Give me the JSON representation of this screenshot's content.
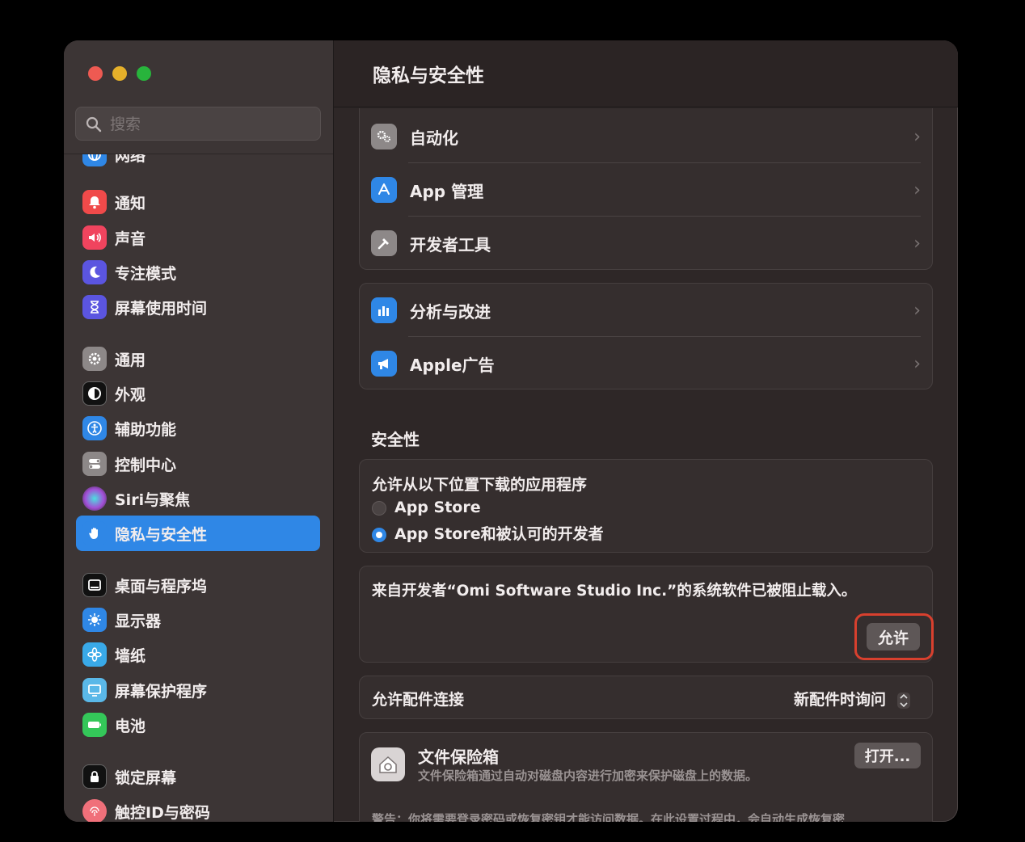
{
  "window": {
    "title": "隐私与安全性"
  },
  "search": {
    "placeholder": "搜索"
  },
  "sidebar": {
    "partial_item": "网络",
    "items": [
      {
        "label": "通知",
        "icon": "bell-icon",
        "color": "#f04a4a"
      },
      {
        "label": "声音",
        "icon": "speaker-icon",
        "color": "#f0445e"
      },
      {
        "label": "专注模式",
        "icon": "moon-icon",
        "color": "#5b55e0"
      },
      {
        "label": "屏幕使用时间",
        "icon": "hourglass-icon",
        "color": "#5b55e0"
      },
      {
        "label": "通用",
        "icon": "gear-icon",
        "color": "#8d8888"
      },
      {
        "label": "外观",
        "icon": "appearance-icon",
        "color": "#111111"
      },
      {
        "label": "辅助功能",
        "icon": "accessibility-icon",
        "color": "#2f87e6"
      },
      {
        "label": "控制中心",
        "icon": "toggles-icon",
        "color": "#8d8888"
      },
      {
        "label": "Siri与聚焦",
        "icon": "siri-icon",
        "color": "#a34fd6"
      },
      {
        "label": "隐私与安全性",
        "icon": "hand-icon",
        "color": "#2f87e6",
        "selected": true
      },
      {
        "label": "桌面与程序坞",
        "icon": "dock-icon",
        "color": "#111111"
      },
      {
        "label": "显示器",
        "icon": "sun-icon",
        "color": "#2f87e6"
      },
      {
        "label": "墙纸",
        "icon": "flower-icon",
        "color": "#39a9e8"
      },
      {
        "label": "屏幕保护程序",
        "icon": "screensaver-icon",
        "color": "#5ab8e8"
      },
      {
        "label": "电池",
        "icon": "battery-icon",
        "color": "#34c759"
      },
      {
        "label": "锁定屏幕",
        "icon": "lock-icon",
        "color": "#111111"
      },
      {
        "label": "触控ID与密码",
        "icon": "fingerprint-icon",
        "color": "#f0707a"
      }
    ]
  },
  "main": {
    "group1": [
      {
        "label": "自动化",
        "icon": "gears-icon",
        "color": "#8d8888"
      },
      {
        "label": "App 管理",
        "icon": "appstore-icon",
        "color": "#2f87e6"
      },
      {
        "label": "开发者工具",
        "icon": "hammer-icon",
        "color": "#8d8888"
      }
    ],
    "group2": [
      {
        "label": "分析与改进",
        "icon": "chart-icon",
        "color": "#2f87e6"
      },
      {
        "label": "Apple广告",
        "icon": "megaphone-icon",
        "color": "#2f87e6"
      }
    ],
    "security_title": "安全性",
    "downloads": {
      "title": "允许从以下位置下载的应用程序",
      "option1": "App Store",
      "option2": "App Store和被认可的开发者",
      "selected": "option2"
    },
    "blocked": {
      "message": "来自开发者“Omi Software Studio Inc.”的系统软件已被阻止载入。",
      "allow_button": "允许",
      "highlight_color": "#d8402e"
    },
    "accessories": {
      "label": "允许配件连接",
      "value": "新配件时询问"
    },
    "filevault": {
      "title": "文件保险箱",
      "description": "文件保险箱通过自动对磁盘内容进行加密来保护磁盘上的数据。",
      "button": "打开...",
      "warning": "警告：你将需要登录密码或恢复密钥才能访问数据。在此设置过程中，会自动生成恢复密"
    }
  }
}
